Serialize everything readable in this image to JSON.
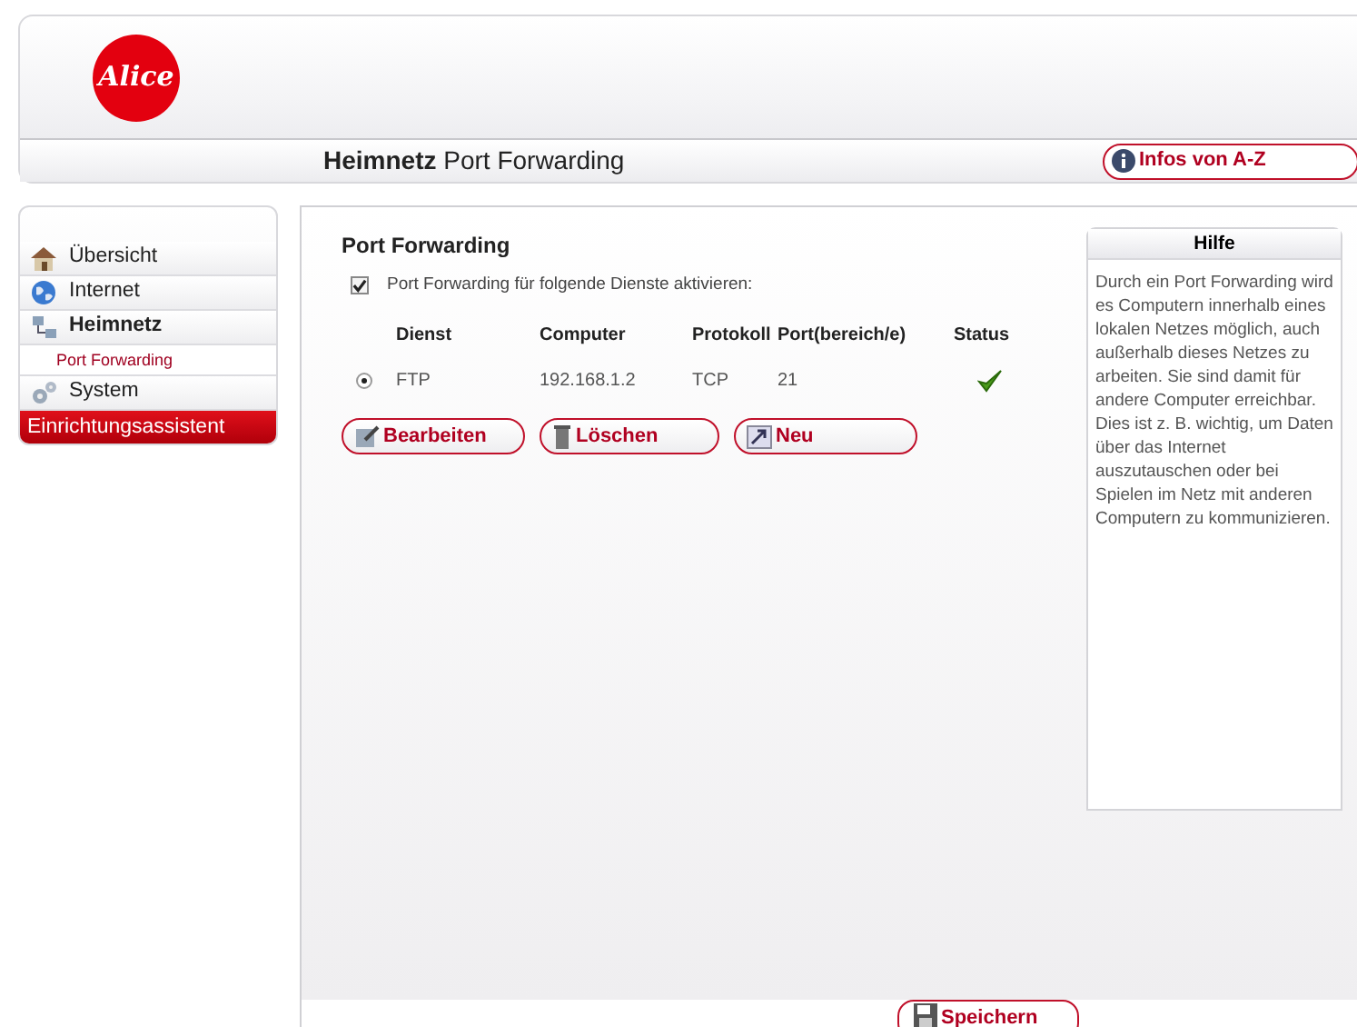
{
  "header": {
    "logo": "Alice",
    "title_bold": "Heimnetz",
    "title": "Port Forwarding",
    "info_button": "Infos von A-Z"
  },
  "sidebar": {
    "items": [
      {
        "label": "Übersicht",
        "kind": "item",
        "selected": false
      },
      {
        "label": "Internet",
        "kind": "item",
        "selected": false
      },
      {
        "label": "Heimnetz",
        "kind": "item",
        "selected": true,
        "children": [
          {
            "label": "Port Forwarding",
            "selected": true
          }
        ]
      },
      {
        "label": "System",
        "kind": "item",
        "selected": false
      },
      {
        "label": "Einrichtungsassistent",
        "kind": "wizard",
        "selected": false
      }
    ]
  },
  "main": {
    "heading": "Port Forwarding",
    "enable": {
      "label": "Port Forwarding für folgende Dienste aktivieren:",
      "checked": true
    },
    "table": {
      "columns": [
        "Dienst",
        "Computer",
        "Protokoll",
        "Port(bereich/e)",
        "Status"
      ],
      "rows": [
        {
          "selected": true,
          "cells": [
            "FTP",
            "192.168.1.2",
            "TCP",
            "21"
          ],
          "active": true
        }
      ]
    },
    "buttons": [
      {
        "label": "Bearbeiten"
      },
      {
        "label": "Löschen"
      },
      {
        "label": "Neu"
      }
    ]
  },
  "help": {
    "title": "Hilfe",
    "text": "Durch ein Port Forwarding wird es Computern innerhalb eines lokalen Netzes möglich, auch außerhalb dieses Netzes zu arbeiten. Sie sind damit für andere Computer erreichbar. Dies ist z. B. wichtig, um Daten über das Internet auszutauschen oder bei Spielen im Netz mit anderen Computern zu kommunizieren."
  },
  "footer": {
    "save_button": "Speichern"
  }
}
